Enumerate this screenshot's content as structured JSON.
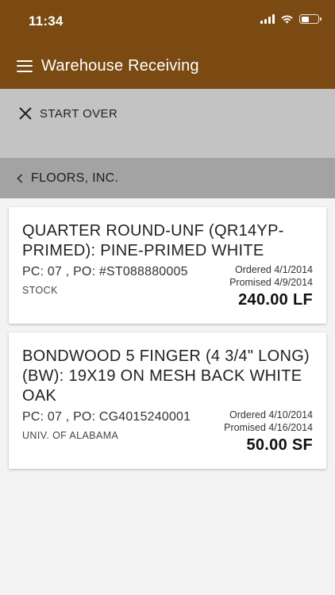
{
  "status_bar": {
    "time": "11:34"
  },
  "header": {
    "title": "Warehouse Receiving"
  },
  "start_over": {
    "label": "START OVER"
  },
  "vendor": {
    "name": "FLOORS, INC."
  },
  "items": [
    {
      "name": "QUARTER ROUND-UNF (QR14YP-PRIMED): PINE-PRIMED WHITE",
      "pc": "PC: 07",
      "po": "PO: #ST088880005",
      "job": "STOCK",
      "ordered": "Ordered 4/1/2014",
      "promised": "Promised 4/9/2014",
      "quantity": "240.00 LF"
    },
    {
      "name": "BONDWOOD 5 FINGER (4 3/4\" LONG) (BW): 19X19 ON MESH BACK WHITE OAK",
      "pc": "PC: 07",
      "po": "PO: CG4015240001",
      "job": "UNIV. OF ALABAMA",
      "ordered": "Ordered 4/10/2014",
      "promised": "Promised 4/16/2014",
      "quantity": "50.00 SF"
    }
  ]
}
